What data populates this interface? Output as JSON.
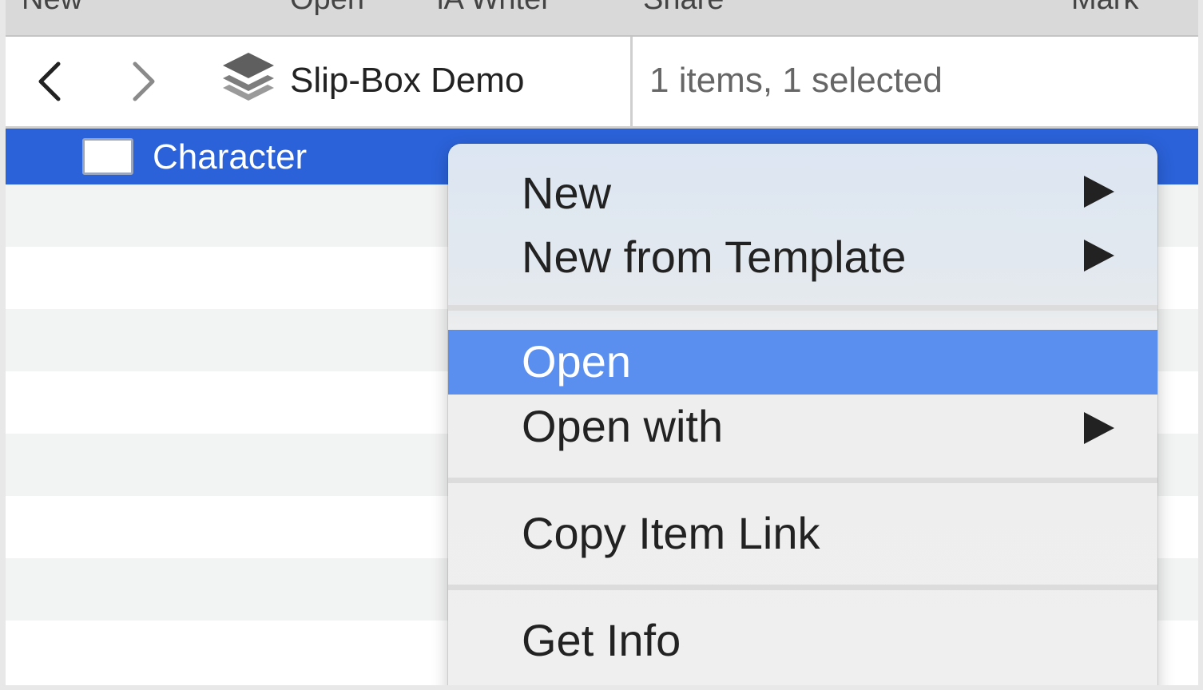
{
  "toolbar": {
    "items": [
      "New",
      "Open",
      "iA Writer",
      "Share",
      "Mark"
    ]
  },
  "pathbar": {
    "title": "Slip-Box Demo",
    "status": "1 items, 1 selected"
  },
  "list": {
    "selected_item": "Character"
  },
  "context_menu": {
    "items": [
      {
        "label": "New",
        "submenu": true
      },
      {
        "label": "New from Template",
        "submenu": true
      },
      {
        "label": "Open",
        "submenu": false,
        "highlighted": true
      },
      {
        "label": "Open with",
        "submenu": true
      },
      {
        "label": "Copy Item Link",
        "submenu": false
      },
      {
        "label": "Get Info",
        "submenu": false
      }
    ]
  },
  "colors": {
    "selection": "#2b62d9",
    "menu_highlight": "#5a8ff0"
  }
}
